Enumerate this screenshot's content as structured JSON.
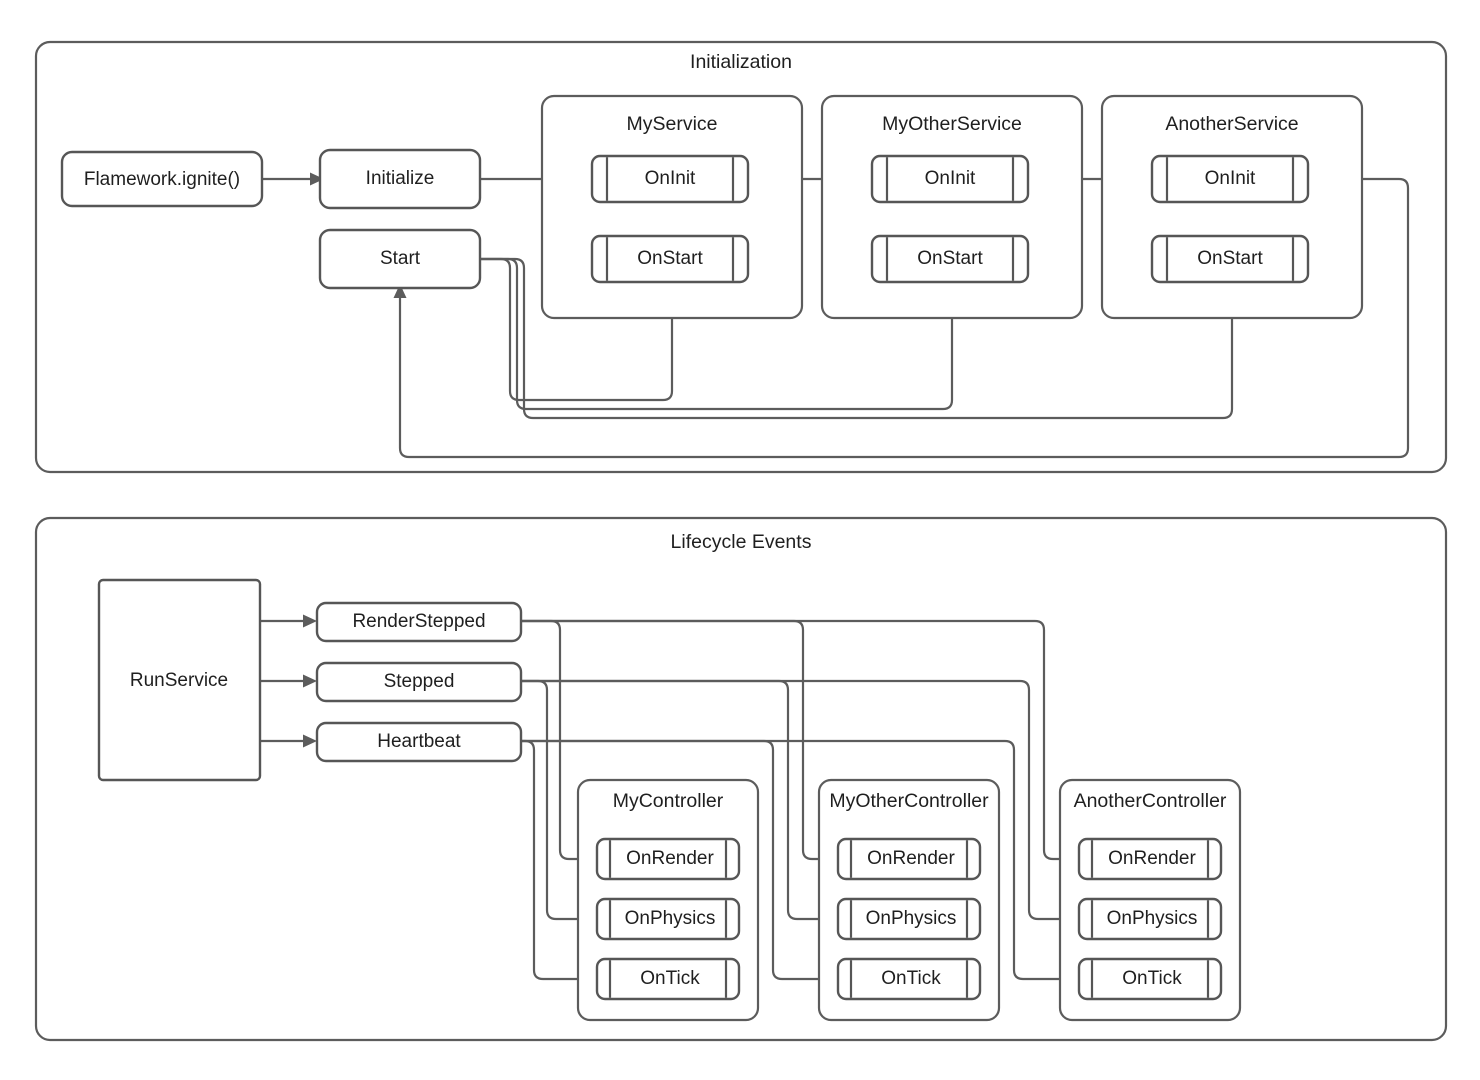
{
  "diagram": {
    "type": "flowchart",
    "stroke_color": "#5c5c5c",
    "text_color": "#1f1f1f",
    "background": "#ffffff",
    "groups": [
      {
        "id": "initialization",
        "title": "Initialization",
        "nodes": [
          {
            "id": "ignite",
            "label": "Flamework.ignite()",
            "shape": "rounded-rect"
          },
          {
            "id": "initialize",
            "label": "Initialize",
            "shape": "rounded-rect"
          },
          {
            "id": "start",
            "label": "Start",
            "shape": "rounded-rect"
          }
        ],
        "services": [
          {
            "id": "myservice",
            "title": "MyService",
            "methods": [
              {
                "id": "myservice-oninit",
                "label": "OnInit",
                "shape": "procedure"
              },
              {
                "id": "myservice-onstart",
                "label": "OnStart",
                "shape": "procedure"
              }
            ]
          },
          {
            "id": "myotherservice",
            "title": "MyOtherService",
            "methods": [
              {
                "id": "myotherservice-oninit",
                "label": "OnInit",
                "shape": "procedure"
              },
              {
                "id": "myotherservice-onstart",
                "label": "OnStart",
                "shape": "procedure"
              }
            ]
          },
          {
            "id": "anotherservice",
            "title": "AnotherService",
            "methods": [
              {
                "id": "anotherservice-oninit",
                "label": "OnInit",
                "shape": "procedure"
              },
              {
                "id": "anotherservice-onstart",
                "label": "OnStart",
                "shape": "procedure"
              }
            ]
          }
        ],
        "edges": [
          {
            "from": "ignite",
            "to": "initialize"
          },
          {
            "from": "initialize",
            "to": "myservice-oninit"
          },
          {
            "from": "myservice-oninit",
            "to": "myotherservice-oninit"
          },
          {
            "from": "myotherservice-oninit",
            "to": "anotherservice-oninit"
          },
          {
            "from": "anotherservice-oninit",
            "to": "start"
          },
          {
            "from": "start",
            "to": "myservice-onstart"
          },
          {
            "from": "start",
            "to": "myotherservice-onstart"
          },
          {
            "from": "start",
            "to": "anotherservice-onstart"
          }
        ]
      },
      {
        "id": "lifecycle",
        "title": "Lifecycle Events",
        "nodes": [
          {
            "id": "runservice",
            "label": "RunService",
            "shape": "rect"
          },
          {
            "id": "renderstepped",
            "label": "RenderStepped",
            "shape": "rounded-rect"
          },
          {
            "id": "stepped",
            "label": "Stepped",
            "shape": "rounded-rect"
          },
          {
            "id": "heartbeat",
            "label": "Heartbeat",
            "shape": "rounded-rect"
          }
        ],
        "controllers": [
          {
            "id": "mycontroller",
            "title": "MyController",
            "methods": [
              {
                "id": "mycontroller-onrender",
                "label": "OnRender",
                "shape": "procedure"
              },
              {
                "id": "mycontroller-onphysics",
                "label": "OnPhysics",
                "shape": "procedure"
              },
              {
                "id": "mycontroller-ontick",
                "label": "OnTick",
                "shape": "procedure"
              }
            ]
          },
          {
            "id": "myothercontroller",
            "title": "MyOtherController",
            "methods": [
              {
                "id": "myothercontroller-onrender",
                "label": "OnRender",
                "shape": "procedure"
              },
              {
                "id": "myothercontroller-onphysics",
                "label": "OnPhysics",
                "shape": "procedure"
              },
              {
                "id": "myothercontroller-ontick",
                "label": "OnTick",
                "shape": "procedure"
              }
            ]
          },
          {
            "id": "anothercontroller",
            "title": "AnotherController",
            "methods": [
              {
                "id": "anothercontroller-onrender",
                "label": "OnRender",
                "shape": "procedure"
              },
              {
                "id": "anothercontroller-onphysics",
                "label": "OnPhysics",
                "shape": "procedure"
              },
              {
                "id": "anothercontroller-ontick",
                "label": "OnTick",
                "shape": "procedure"
              }
            ]
          }
        ],
        "edges": [
          {
            "from": "runservice",
            "to": "renderstepped"
          },
          {
            "from": "runservice",
            "to": "stepped"
          },
          {
            "from": "runservice",
            "to": "heartbeat"
          },
          {
            "from": "renderstepped",
            "to": "mycontroller-onrender"
          },
          {
            "from": "renderstepped",
            "to": "myothercontroller-onrender"
          },
          {
            "from": "renderstepped",
            "to": "anothercontroller-onrender"
          },
          {
            "from": "stepped",
            "to": "mycontroller-onphysics"
          },
          {
            "from": "stepped",
            "to": "myothercontroller-onphysics"
          },
          {
            "from": "stepped",
            "to": "anothercontroller-onphysics"
          },
          {
            "from": "heartbeat",
            "to": "mycontroller-ontick"
          },
          {
            "from": "heartbeat",
            "to": "myothercontroller-ontick"
          },
          {
            "from": "heartbeat",
            "to": "anothercontroller-ontick"
          }
        ]
      }
    ]
  }
}
